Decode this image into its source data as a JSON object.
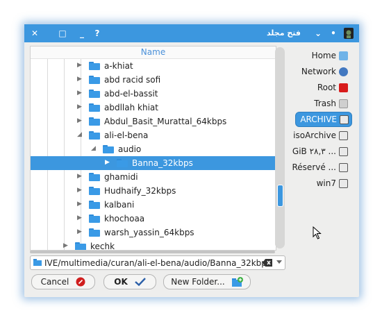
{
  "window": {
    "title": "فتح مجلد",
    "close_glyph": "✕",
    "maximize_glyph": "□",
    "minimize_glyph": "_",
    "help_glyph": "?",
    "menu_glyph": "⌄",
    "dot_glyph": "•"
  },
  "tree": {
    "column_header": "Name",
    "rows": [
      {
        "label": "a-khiat",
        "expanded": false
      },
      {
        "label": "abd racid sofi",
        "expanded": false
      },
      {
        "label": "abd-el-bassit",
        "expanded": false
      },
      {
        "label": "abdllah khiat",
        "expanded": false
      },
      {
        "label": "Abdul_Basit_Murattal_64kbps",
        "expanded": false
      },
      {
        "label": "ali-el-bena",
        "expanded": true
      },
      {
        "label": "audio",
        "expanded": true
      },
      {
        "label": "Banna_32kbps",
        "expanded": false,
        "selected": true
      },
      {
        "label": "ghamidi",
        "expanded": false
      },
      {
        "label": "Hudhaify_32kbps",
        "expanded": false
      },
      {
        "label": "kalbani",
        "expanded": false
      },
      {
        "label": "khochoaa",
        "expanded": false
      },
      {
        "label": "warsh_yassin_64kbps",
        "expanded": false
      },
      {
        "label": "kechk",
        "expanded": false
      }
    ]
  },
  "sidebar": {
    "places": [
      {
        "label": "Home",
        "icon": "home-icon"
      },
      {
        "label": "Network",
        "icon": "network-globe-icon"
      },
      {
        "label": "Root",
        "icon": "root-folder-icon"
      },
      {
        "label": "Trash",
        "icon": "trash-icon"
      },
      {
        "label": "ARCHIVE",
        "icon": "drive-icon",
        "active": true
      },
      {
        "label": "isoArchive",
        "icon": "drive-icon"
      },
      {
        "label": "GiB ٢٨,٣ ...",
        "icon": "drive-icon"
      },
      {
        "label": "Réservé ...",
        "icon": "drive-icon"
      },
      {
        "label": "win7",
        "icon": "drive-icon"
      }
    ]
  },
  "pathbar": {
    "value": "IVE/multimedia/curan/ali-el-bena/audio/Banna_32kbps"
  },
  "buttons": {
    "cancel": "Cancel",
    "ok": "OK",
    "new_folder": "New Folder..."
  },
  "colors": {
    "accent": "#3c97df",
    "folder": "#3a9ae6",
    "cancel_icon": "#d01e1e"
  }
}
